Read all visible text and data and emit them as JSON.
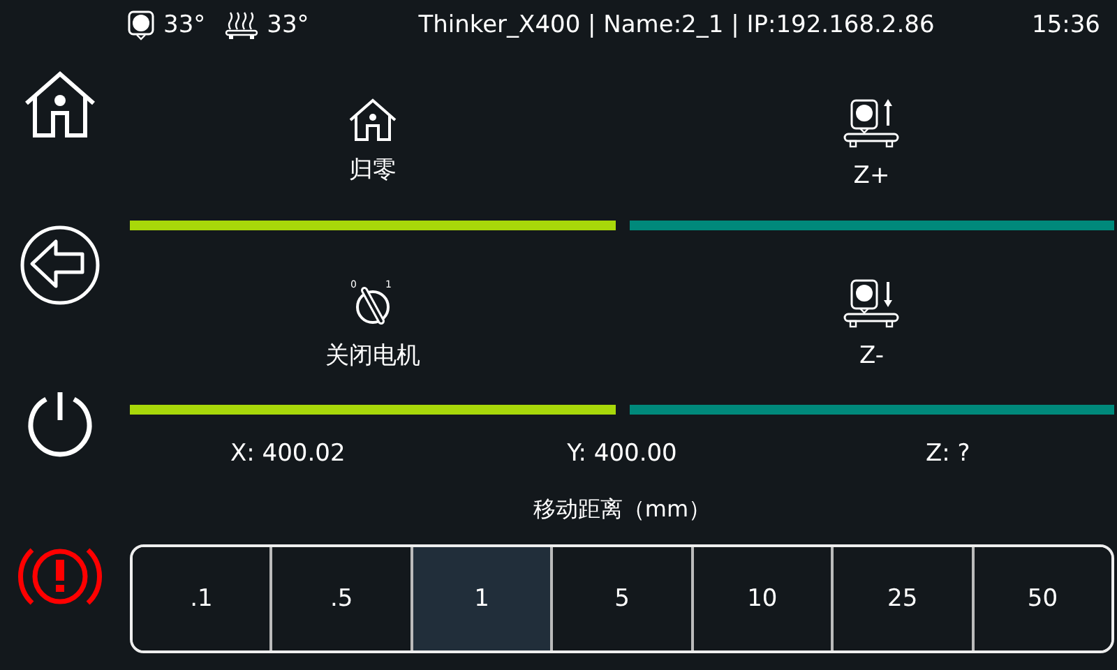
{
  "status_bar": {
    "nozzle_temp": "33°",
    "bed_temp": "33°",
    "title": "Thinker_X400 | Name:2_1 | IP:192.168.2.86",
    "time": "15:36"
  },
  "actions": [
    {
      "kind": "home",
      "label": "归零",
      "color": "#a8d80a"
    },
    {
      "kind": "z-up",
      "label": "Z+",
      "color": "#00897b"
    },
    {
      "kind": "motor-off",
      "label": "关闭电机",
      "color": "#a8d80a",
      "switch_marks": [
        "0",
        "1"
      ]
    },
    {
      "kind": "z-down",
      "label": "Z-",
      "color": "#00897b"
    }
  ],
  "positions": [
    "X: 400.02",
    "Y: 400.00",
    "Z: ?"
  ],
  "distance": {
    "label": "移动距离（mm）",
    "options": [
      {
        "label": ".1",
        "selected": false
      },
      {
        "label": ".5",
        "selected": false
      },
      {
        "label": "1",
        "selected": true
      },
      {
        "label": "5",
        "selected": false
      },
      {
        "label": "10",
        "selected": false
      },
      {
        "label": "25",
        "selected": false
      },
      {
        "label": "50",
        "selected": false
      }
    ]
  }
}
